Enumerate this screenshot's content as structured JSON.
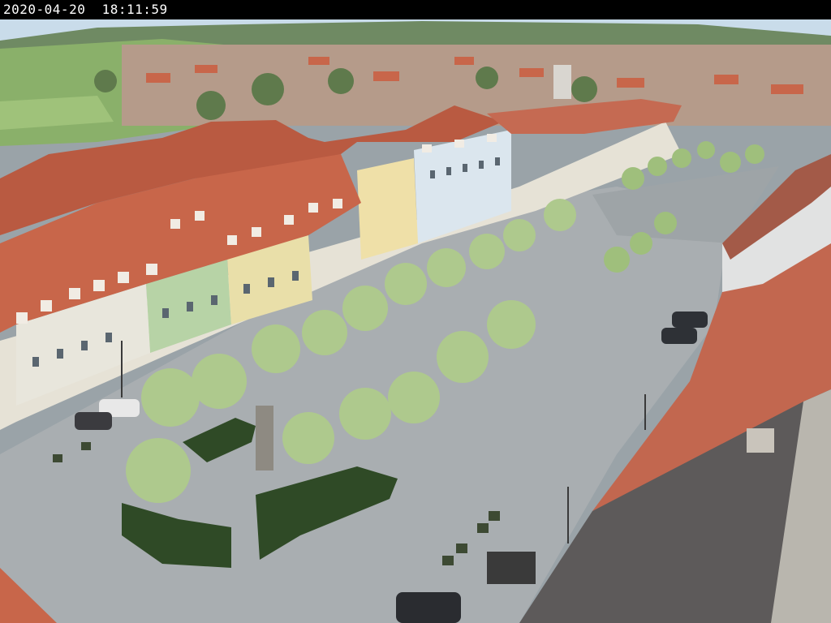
{
  "overlay": {
    "timestamp": "2020-04-20  18:11:59"
  },
  "colors": {
    "sky": "#c9dcea",
    "roof_red": "#c8664a",
    "roof_dark": "#5d5a5a",
    "plaza": "#a9aeb1",
    "tree": "#a9c48a",
    "hedge": "#2f4a26",
    "field": "#8ab06a"
  }
}
